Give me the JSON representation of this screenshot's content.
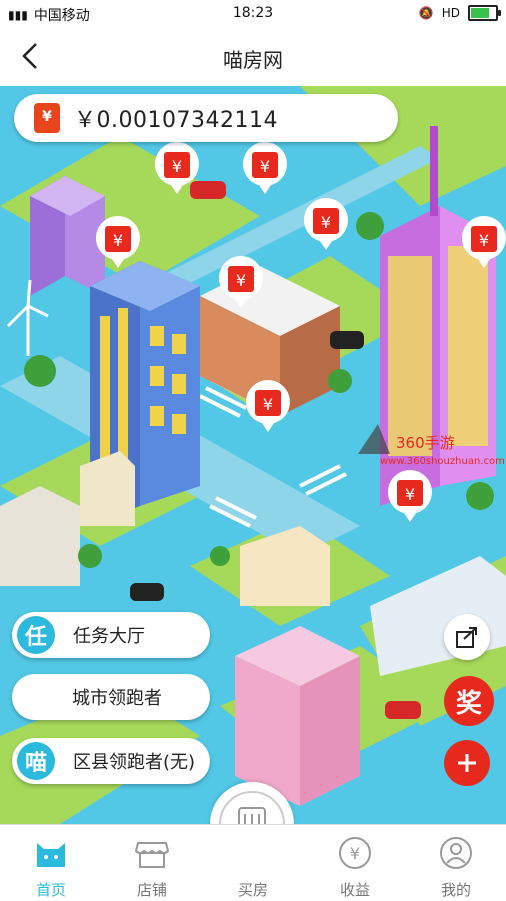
{
  "status_bar": {
    "carrier": "中国移动",
    "time": "18:23"
  },
  "header": {
    "title": "喵房网"
  },
  "balance": {
    "icon_symbol": "¥",
    "amount": "￥0.00107342114"
  },
  "menu": {
    "task_hall": {
      "badge": "任",
      "label": "任务大厅"
    },
    "city_leader": {
      "label": "城市领跑者"
    },
    "county_leader": {
      "badge": "喵",
      "label": "区县领跑者(无)"
    }
  },
  "actions": {
    "reward_label": "奖",
    "share_icon": "share-icon",
    "add_icon": "plus-icon"
  },
  "watermark": {
    "title": "360手游",
    "url": "www.360shouzhuan.com"
  },
  "tabs": [
    {
      "label": "首页",
      "icon": "cat-icon"
    },
    {
      "label": "店铺",
      "icon": "shop-icon"
    },
    {
      "label": "买房",
      "icon": "building-icon"
    },
    {
      "label": "收益",
      "icon": "coin-icon"
    },
    {
      "label": "我的",
      "icon": "user-icon"
    }
  ],
  "colors": {
    "accent": "#2bbadd",
    "red": "#e8291e",
    "water": "#52c8e6"
  }
}
